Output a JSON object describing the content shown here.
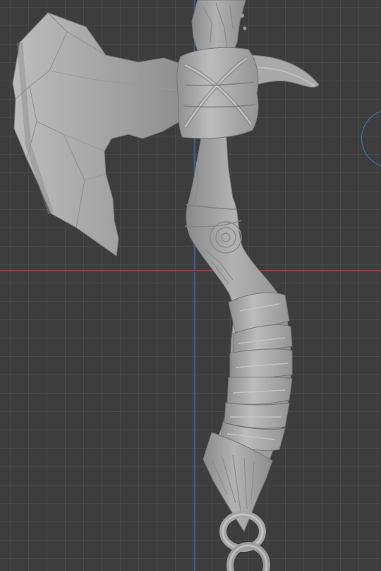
{
  "viewport": {
    "background": "#3d3d3d",
    "axis_x_color": "#9b3a42",
    "axis_y_color": "#3b5e94",
    "gizmo_color": "#3f78c4",
    "model_color": "#a9a9a9"
  },
  "model": {
    "parts": [
      "axe-blade",
      "back-spike",
      "binding-wrap",
      "handle",
      "handle-wraps",
      "pommel",
      "chain-rings"
    ]
  }
}
